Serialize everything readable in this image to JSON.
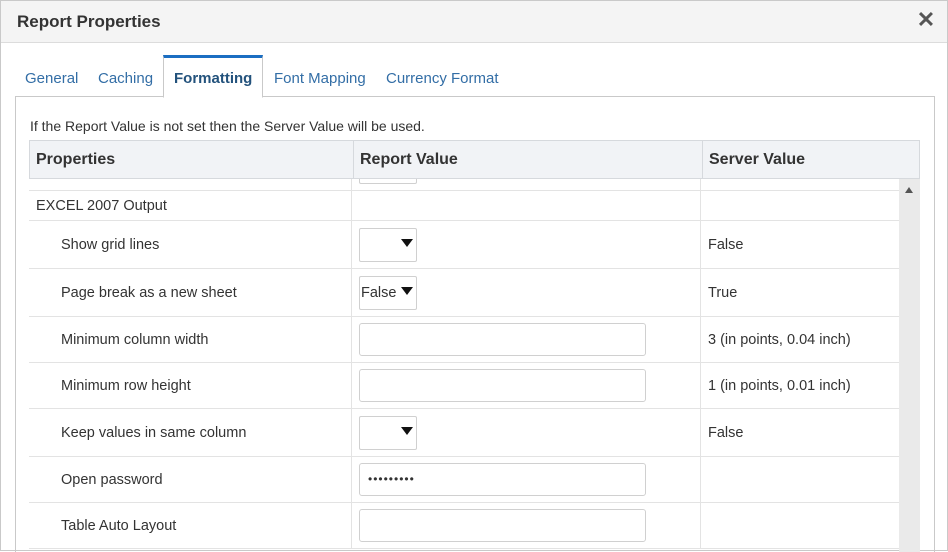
{
  "dialog": {
    "title": "Report Properties",
    "close_glyph": "✕"
  },
  "tabs": [
    {
      "label": "General",
      "active": false
    },
    {
      "label": "Caching",
      "active": false
    },
    {
      "label": "Formatting",
      "active": true
    },
    {
      "label": "Font Mapping",
      "active": false
    },
    {
      "label": "Currency Format",
      "active": false
    }
  ],
  "note": "If the Report Value is not set then the Server Value will be used.",
  "table": {
    "headers": {
      "properties": "Properties",
      "report_value": "Report Value",
      "server_value": "Server Value"
    },
    "section": "EXCEL 2007 Output",
    "rows": [
      {
        "label": "Show grid lines",
        "control": "select",
        "value": "",
        "server": "False"
      },
      {
        "label": "Page break as a new sheet",
        "control": "select",
        "value": "False",
        "server": "True"
      },
      {
        "label": "Minimum column width",
        "control": "input",
        "value": "",
        "server": "3 (in points, 0.04 inch)"
      },
      {
        "label": "Minimum row height",
        "control": "input",
        "value": "",
        "server": "1 (in points, 0.01 inch)"
      },
      {
        "label": "Keep values in same column",
        "control": "select",
        "value": "",
        "server": "False"
      },
      {
        "label": "Open password",
        "control": "password",
        "value": "•••••••••",
        "server": ""
      },
      {
        "label": "Table Auto Layout",
        "control": "input",
        "value": "",
        "server": ""
      }
    ]
  },
  "colors": {
    "tab_link": "#336ea6",
    "tab_active_border": "#1b6ec2",
    "header_bg": "#f1f3f6"
  }
}
